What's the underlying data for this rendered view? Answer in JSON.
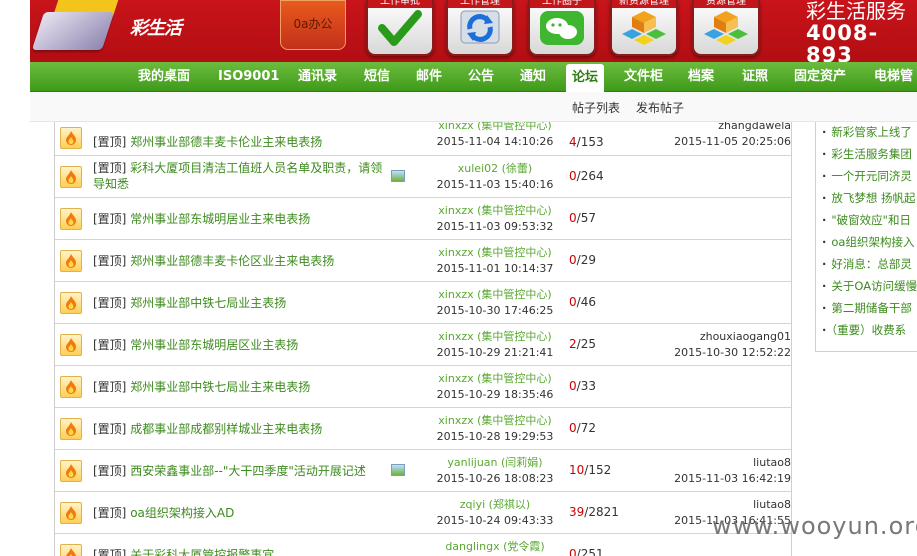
{
  "header": {
    "logo_text": "彩生活",
    "oa_label": "0a办公",
    "top_icons": [
      {
        "name": "工作审批",
        "icon": "check-icon"
      },
      {
        "name": "工作管理",
        "icon": "refresh-icon"
      },
      {
        "name": "工作圈子",
        "icon": "wechat-icon"
      },
      {
        "name": "新资源管理",
        "icon": "cubes-icon"
      },
      {
        "name": "资源管理",
        "icon": "cubes-icon"
      }
    ],
    "hotline_title": "彩生活服务",
    "hotline_number": "4008-893"
  },
  "nav": {
    "items": [
      "我的桌面",
      "ISO9001",
      "通讯录",
      "短信",
      "邮件",
      "公告",
      "通知",
      "论坛",
      "文件柜",
      "档案",
      "证照",
      "固定资产",
      "电梯管"
    ],
    "active_index": 7
  },
  "subnav": {
    "items": [
      "帖子列表",
      "发布帖子"
    ]
  },
  "posts": [
    {
      "tag": "[置顶]",
      "title": "郑州事业部德丰麦卡伦业主来电表扬",
      "author": "xinxzx (集中管控中心)",
      "date": "2015-11-04 14:10:26",
      "replies": "4",
      "views": "153",
      "last_user": "zhangdawela",
      "last_date": "2015-11-05 20:25:06",
      "pic": false
    },
    {
      "tag": "[置顶]",
      "title": "彩科大厦项目清洁工值班人员名单及职责，请领导知悉",
      "author": "xulei02 (徐蕾)",
      "date": "2015-11-03 15:40:16",
      "replies": "0",
      "views": "264",
      "last_user": "",
      "last_date": "",
      "pic": true
    },
    {
      "tag": "[置顶]",
      "title": "常州事业部东城明居业主来电表扬",
      "author": "xinxzx (集中管控中心)",
      "date": "2015-11-03 09:53:32",
      "replies": "0",
      "views": "57",
      "last_user": "",
      "last_date": "",
      "pic": false
    },
    {
      "tag": "[置顶]",
      "title": "郑州事业部德丰麦卡伦区业主来电表扬",
      "author": "xinxzx (集中管控中心)",
      "date": "2015-11-01 10:14:37",
      "replies": "0",
      "views": "29",
      "last_user": "",
      "last_date": "",
      "pic": false
    },
    {
      "tag": "[置顶]",
      "title": "郑州事业部中铁七局业主表扬",
      "author": "xinxzx (集中管控中心)",
      "date": "2015-10-30 17:46:25",
      "replies": "0",
      "views": "46",
      "last_user": "",
      "last_date": "",
      "pic": false
    },
    {
      "tag": "[置顶]",
      "title": "常州事业部东城明居区业主表扬",
      "author": "xinxzx (集中管控中心)",
      "date": "2015-10-29 21:21:41",
      "replies": "2",
      "views": "25",
      "last_user": "zhouxiaogang01",
      "last_date": "2015-10-30 12:52:22",
      "pic": false
    },
    {
      "tag": "[置顶]",
      "title": "郑州事业部中铁七局业主来电表扬",
      "author": "xinxzx (集中管控中心)",
      "date": "2015-10-29 18:35:46",
      "replies": "0",
      "views": "33",
      "last_user": "",
      "last_date": "",
      "pic": false
    },
    {
      "tag": "[置顶]",
      "title": "成都事业部成都别样城业主来电表扬",
      "author": "xinxzx (集中管控中心)",
      "date": "2015-10-28 19:29:53",
      "replies": "0",
      "views": "72",
      "last_user": "",
      "last_date": "",
      "pic": false
    },
    {
      "tag": "[置顶]",
      "title": "西安荣鑫事业部--\"大干四季度\"活动开展记述",
      "author": "yanlijuan (闫莉娟)",
      "date": "2015-10-26 18:08:23",
      "replies": "10",
      "views": "152",
      "last_user": "liutao8",
      "last_date": "2015-11-03 16:42:19",
      "pic": true
    },
    {
      "tag": "[置顶]",
      "title": "oa组织架构接入AD",
      "author": "zqiyi (郑祺以)",
      "date": "2015-10-24 09:43:33",
      "replies": "39",
      "views": "2821",
      "last_user": "liutao8",
      "last_date": "2015-11-03 16:41:55",
      "pic": false
    },
    {
      "tag": "[置顶]",
      "title": "关于彩科大厦管控报警事宜",
      "author": "danglingx (党令霞)",
      "date": "",
      "replies": "0",
      "views": "251",
      "last_user": "",
      "last_date": "",
      "pic": false
    }
  ],
  "sidebar": {
    "items": [
      "新彩管家上线了",
      "彩生活服务集团",
      "一个开元同济灵",
      "放飞梦想 扬帆起",
      "\"破窗效应\"和日",
      "oa组织架构接入",
      "好消息：总部灵",
      "关于OA访问缓慢",
      "第二期储备干部",
      "（重要）收费系"
    ]
  },
  "watermark": "www.wooyun.org",
  "colors": {
    "header_red": "#c8141a",
    "nav_green": "#4fa827",
    "link_green": "#3d8b1e",
    "count_red": "#cc0000"
  }
}
